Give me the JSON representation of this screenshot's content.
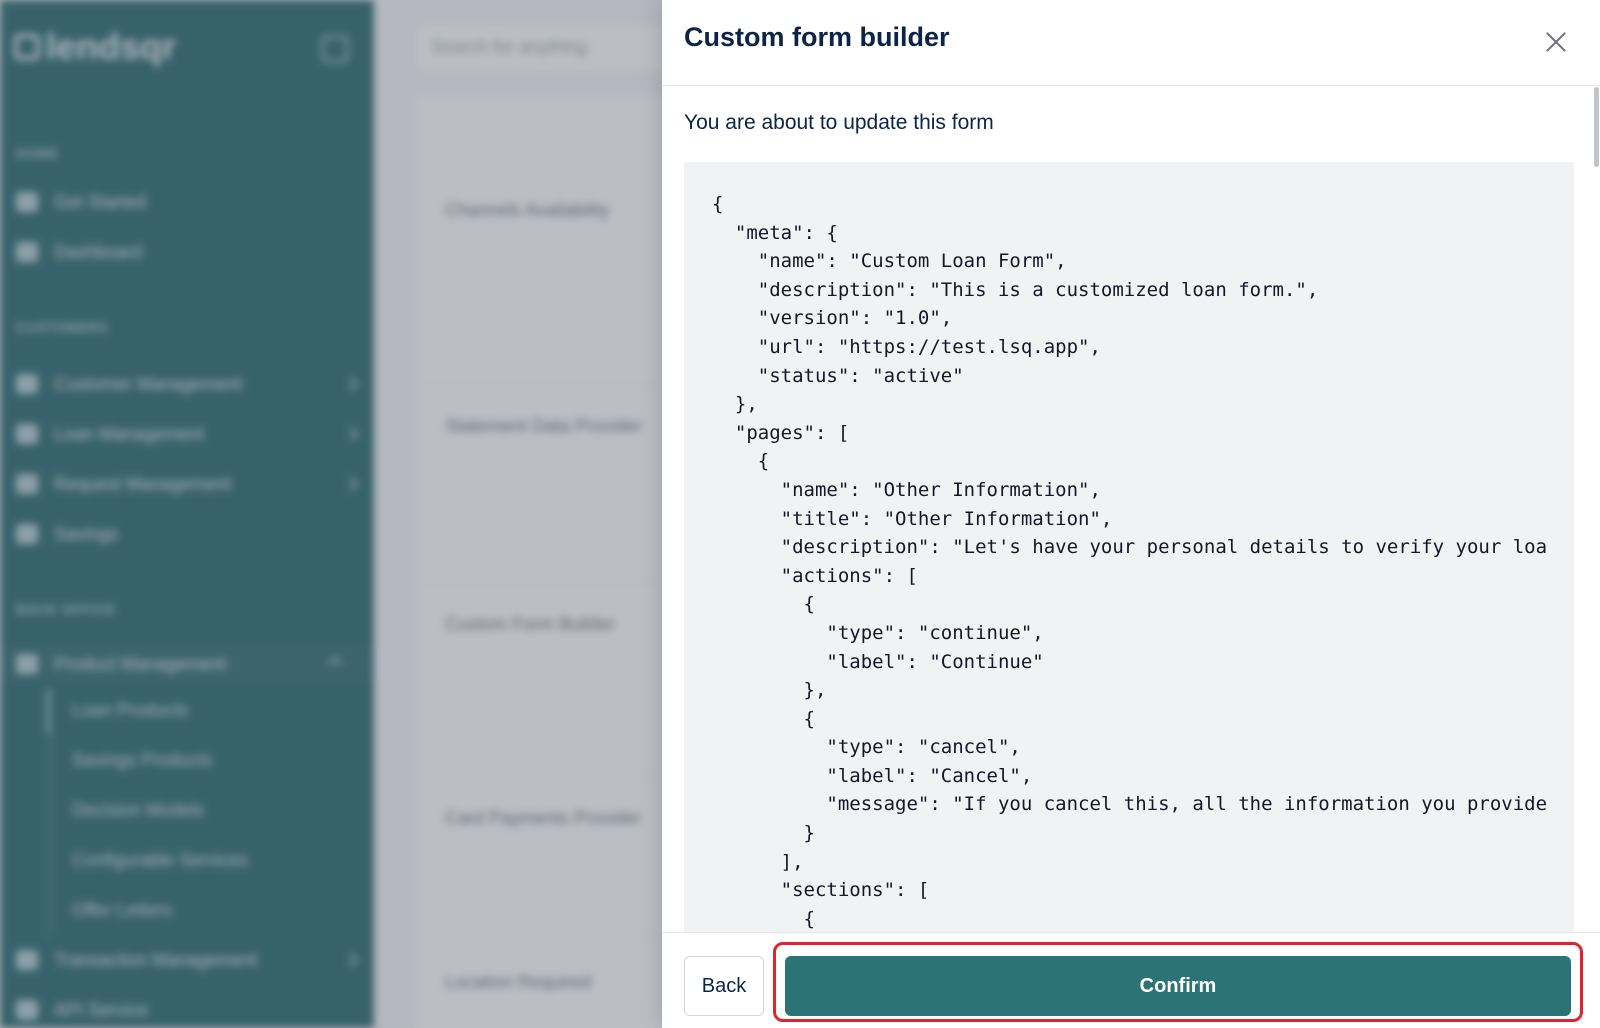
{
  "app": {
    "brand": "lendsqr",
    "search_placeholder": "Search for anything"
  },
  "sidebar": {
    "sections": [
      {
        "label": "HOME"
      },
      {
        "label": "CUSTOMERS"
      },
      {
        "label": "BACK OFFICE"
      }
    ],
    "items": [
      {
        "label": "Get Started"
      },
      {
        "label": "Dashboard"
      },
      {
        "label": "Customer Management"
      },
      {
        "label": "Loan Management"
      },
      {
        "label": "Request Management"
      },
      {
        "label": "Savings"
      },
      {
        "label": "Product Management"
      },
      {
        "label": "Transaction Management"
      },
      {
        "label": "API Service"
      }
    ],
    "sub_items": [
      {
        "label": "Loan Products"
      },
      {
        "label": "Savings Products"
      },
      {
        "label": "Decision Models"
      },
      {
        "label": "Configurable Services"
      },
      {
        "label": "Offer Letters"
      }
    ]
  },
  "main": {
    "rows": [
      {
        "label": "Channels Availability"
      },
      {
        "label": "Statement Data Provider"
      },
      {
        "label": "Custom Form Builder"
      },
      {
        "label": "Card Payments Provider"
      },
      {
        "label": "Location Required"
      }
    ]
  },
  "drawer": {
    "title": "Custom form builder",
    "subtitle": "You are about to update this form",
    "code_lines": [
      "{",
      "  \"meta\": {",
      "    \"name\": \"Custom Loan Form\",",
      "    \"description\": \"This is a customized loan form.\",",
      "    \"version\": \"1.0\",",
      "    \"url\": \"https://test.lsq.app\",",
      "    \"status\": \"active\"",
      "  },",
      "  \"pages\": [",
      "    {",
      "      \"name\": \"Other Information\",",
      "      \"title\": \"Other Information\",",
      "      \"description\": \"Let's have your personal details to verify your loa",
      "      \"actions\": [",
      "        {",
      "          \"type\": \"continue\",",
      "          \"label\": \"Continue\"",
      "        },",
      "        {",
      "          \"type\": \"cancel\",",
      "          \"label\": \"Cancel\",",
      "          \"message\": \"If you cancel this, all the information you provide",
      "        }",
      "      ],",
      "      \"sections\": [",
      "        {"
    ],
    "back_label": "Back",
    "confirm_label": "Confirm"
  },
  "colors": {
    "sidebar_bg": "#2d6b70",
    "primary": "#2b7375",
    "title_text": "#0b2447",
    "highlight": "#e0242b"
  }
}
